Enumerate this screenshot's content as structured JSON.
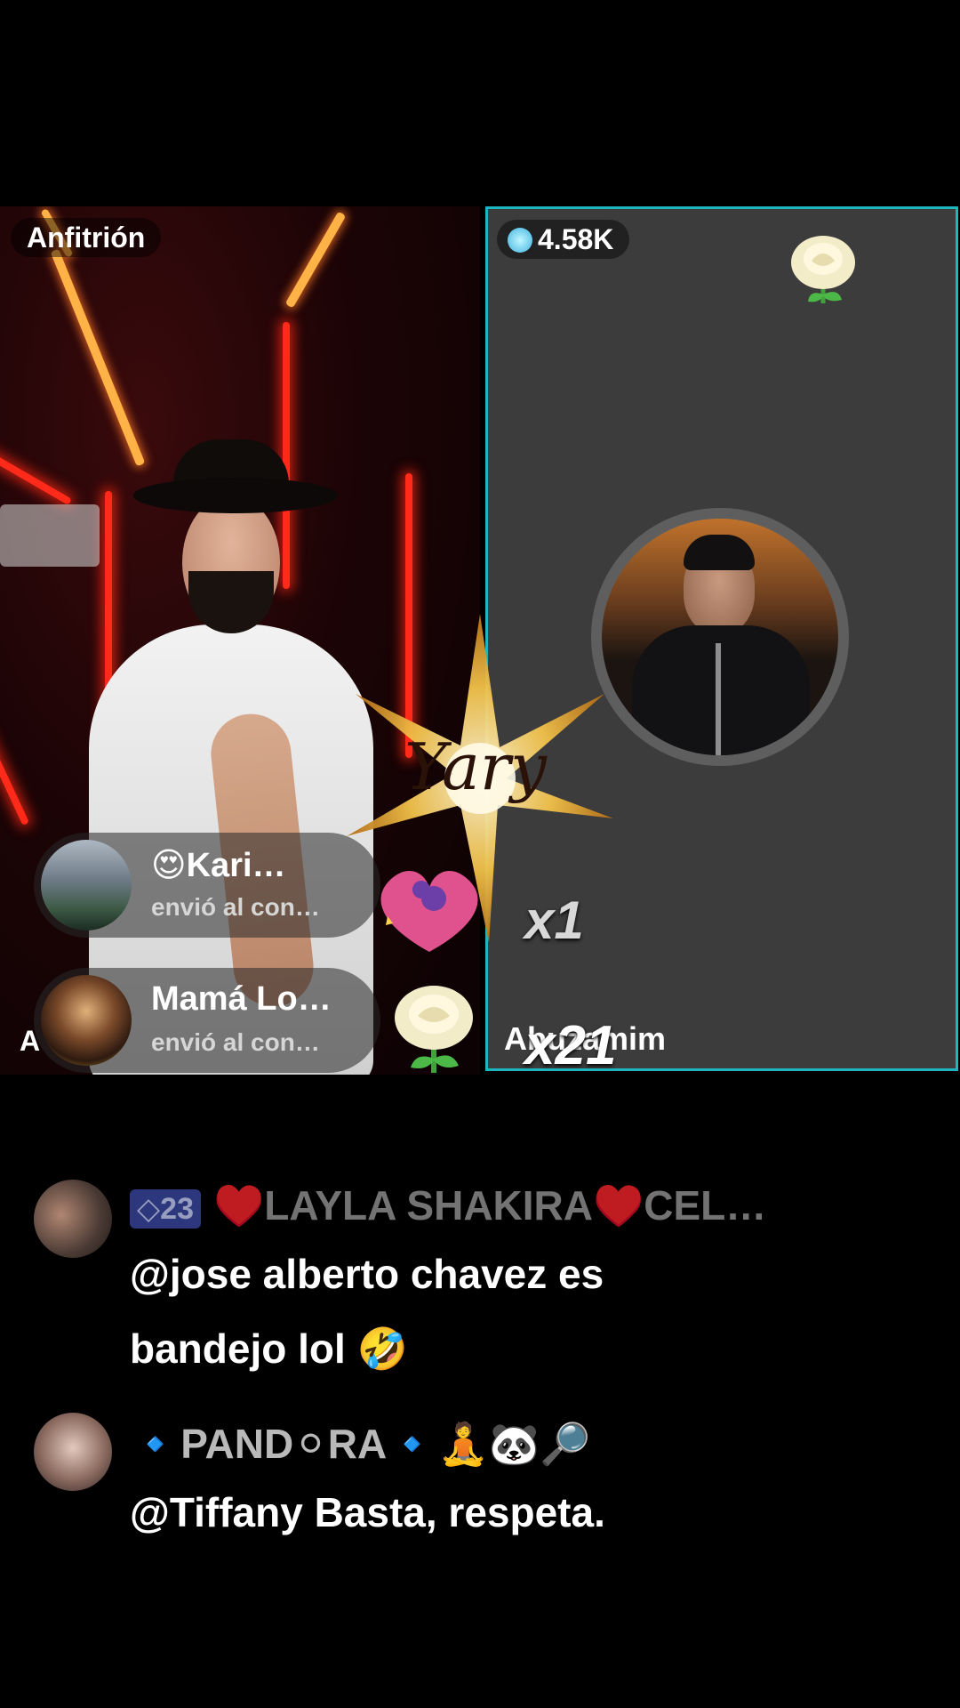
{
  "host": {
    "label": "Anfitrión",
    "partial_name": "A"
  },
  "guest": {
    "score": "4.58K",
    "name": "Abuzamim"
  },
  "gifts": [
    {
      "user": "😍Kari…",
      "action": "envió al con…",
      "multiplier": "x1"
    },
    {
      "user": "Mamá Lo…",
      "action": "envió al con…",
      "multiplier": "x21"
    }
  ],
  "overlay": {
    "star_text": "Yary"
  },
  "comments": [
    {
      "level": "23",
      "user": "♥️LAYLA SHAKIRA♥️CEL…",
      "text_line1": "@jose alberto chavez es",
      "text_line2": "bandejo lol 🤣"
    },
    {
      "user": "🔹PAND⚪RA🔹🧘🐼🔎",
      "text_line1": "@Tiffany Basta, respeta."
    }
  ],
  "colors": {
    "guest_border": "#1cb6c0",
    "neon": "#ff2a1a",
    "level_badge": "#3d4aa8"
  }
}
